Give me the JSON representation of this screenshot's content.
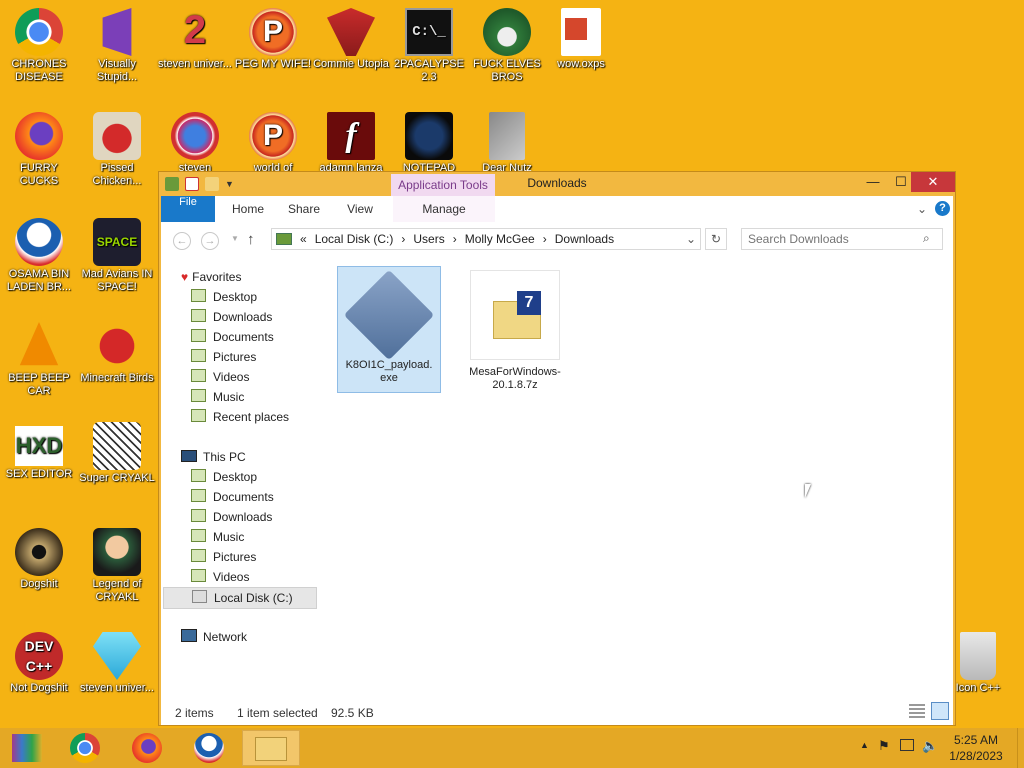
{
  "desktop": {
    "icons": [
      {
        "label": "CHRONES DISEASE",
        "icon": "chrome-icon"
      },
      {
        "label": "Visually Stupid...",
        "icon": "visual-studio-icon"
      },
      {
        "label": "steven univer...",
        "icon": "steven-universe-icon"
      },
      {
        "label": "PEG MY WIFE!",
        "icon": "peggle-icon"
      },
      {
        "label": "Commie Utopia",
        "icon": "communist-emblem-icon"
      },
      {
        "label": "2PACALYPSE 2.3",
        "icon": "command-prompt-icon"
      },
      {
        "label": "FUCK ELVES BROS",
        "icon": "elf-icon"
      },
      {
        "label": "wow.oxps",
        "icon": "oxps-document-icon"
      },
      {
        "label": "FURRY CUCKS",
        "icon": "firefox-icon"
      },
      {
        "label": "Pissed Chicken...",
        "icon": "angry-birds-seasons-icon"
      },
      {
        "label": "steven",
        "icon": "gem-icon"
      },
      {
        "label": "world of",
        "icon": "peggle-icon"
      },
      {
        "label": "adamn lanza",
        "icon": "flash-icon"
      },
      {
        "label": "NOTEPAD",
        "icon": "notepad-icon"
      },
      {
        "label": "Dear Nutz",
        "icon": "stacked-windows-icon"
      },
      {
        "label": "OSAMA BIN LADEN BR...",
        "icon": "obama-logo-icon"
      },
      {
        "label": "Mad Avians IN SPACE!",
        "icon": "angry-birds-space-icon"
      },
      {
        "label": "BEEP BEEP CAR",
        "icon": "vlc-cone-icon"
      },
      {
        "label": "Minecraft Birds",
        "icon": "angry-bird-icon"
      },
      {
        "label": "SEX EDITOR",
        "icon": "hxd-icon"
      },
      {
        "label": "Super CRYAKL",
        "icon": "pixel-character-icon"
      },
      {
        "label": "Dogshit",
        "icon": "cd-icon"
      },
      {
        "label": "Legend of CRYAKL",
        "icon": "anime-character-icon"
      },
      {
        "label": "Not Dogshit",
        "icon": "dev-cpp-icon"
      },
      {
        "label": "steven univer...",
        "icon": "diamond-icon"
      },
      {
        "label": "Icon C++",
        "icon": "recycle-bin-icon"
      }
    ]
  },
  "window": {
    "title": "Downloads",
    "context_tab": "Application Tools",
    "minimize": "—",
    "maximize": "☐",
    "close": "✕",
    "ribbon_tabs": [
      "File",
      "Home",
      "Share",
      "View",
      "Manage"
    ],
    "address": {
      "prefix": "«",
      "parts": [
        "Local Disk (C:)",
        "Users",
        "Molly McGee",
        "Downloads"
      ]
    },
    "search_placeholder": "Search Downloads",
    "nav": {
      "favorites_header": "Favorites",
      "favorites": [
        "Desktop",
        "Downloads",
        "Documents",
        "Pictures",
        "Videos",
        "Music",
        "Recent places"
      ],
      "this_pc_header": "This PC",
      "this_pc": [
        "Desktop",
        "Documents",
        "Downloads",
        "Music",
        "Pictures",
        "Videos",
        "Local Disk (C:)"
      ],
      "network": "Network"
    },
    "files": [
      {
        "name": "K8OI1C_payload.exe",
        "icon": "exe-application-icon",
        "selected": true
      },
      {
        "name": "MesaForWindows-20.1.8.7z",
        "icon": "7z-archive-icon",
        "selected": false
      }
    ],
    "status": {
      "items": "2 items",
      "selected": "1 item selected",
      "size": "92.5 KB"
    }
  },
  "taskbar": {
    "apps": [
      "winrar-icon",
      "chrome-icon",
      "firefox-icon",
      "obama-logo-icon",
      "file-explorer-icon"
    ],
    "time": "5:25 AM",
    "date": "1/28/2023"
  },
  "colors": {
    "desktop": "#f5b313",
    "file_tab": "#1979ca",
    "close": "#c7373b",
    "selection": "#cce4f7"
  }
}
